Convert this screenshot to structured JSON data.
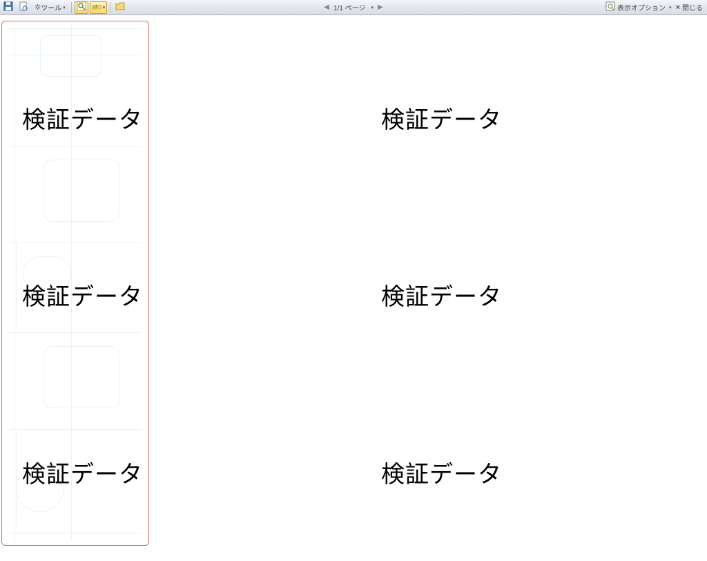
{
  "toolbar": {
    "tools_label": "ツール",
    "display_options_label": "表示オプション",
    "close_label": "閉じる",
    "icons": {
      "save": "save-icon",
      "page_preview": "page-preview-icon",
      "tools_astro": "tools-icon",
      "zoom": "zoom-icon",
      "highlight": "highlight-icon",
      "open_folder": "open-folder-icon",
      "display_options": "display-options-icon",
      "close": "close-icon"
    }
  },
  "pager": {
    "current": 1,
    "total": 1,
    "page_text": "1/1 ページ"
  },
  "document": {
    "grid": [
      [
        "検証データ",
        "検証データ"
      ],
      [
        "検証データ",
        "検証データ"
      ],
      [
        "検証データ",
        "検証データ"
      ]
    ]
  }
}
